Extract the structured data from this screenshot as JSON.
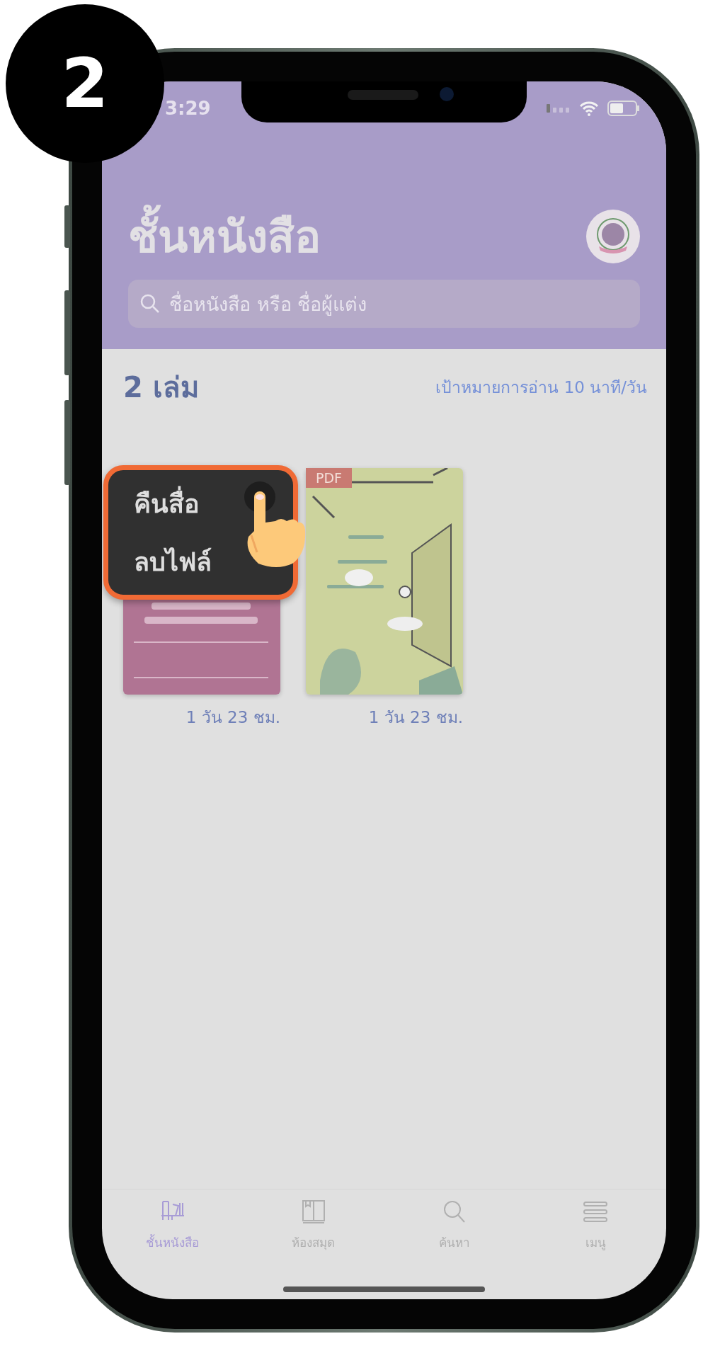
{
  "step_badge": "2",
  "status_bar": {
    "time": "3:29"
  },
  "header": {
    "title": "ชั้นหนังสือ",
    "search": {
      "placeholder": "ชื่อหนังสือ หรือ ชื่อผู้แต่ง"
    }
  },
  "summary": {
    "count": "2 เล่ม",
    "reading_goal": "เป้าหมายการอ่าน 10 นาที/วัน"
  },
  "books": [
    {
      "kind": "picture",
      "time_left": "1 วัน 23 ชม."
    },
    {
      "kind": "picture",
      "badge": "PDF",
      "time_left": "1 วัน 23 ชม."
    }
  ],
  "context_menu": {
    "items": [
      "คืนสื่อ",
      "ลบไฟล์"
    ]
  },
  "tab_bar": [
    {
      "label": "ชั้นหนังสือ",
      "selected": true
    },
    {
      "label": "ห้องสมุด",
      "selected": false
    },
    {
      "label": "ค้นหา",
      "selected": false
    },
    {
      "label": "เมนู",
      "selected": false
    }
  ]
}
